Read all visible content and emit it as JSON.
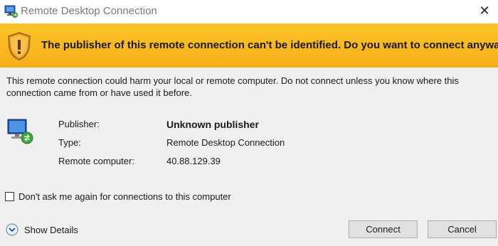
{
  "window": {
    "title": "Remote Desktop Connection",
    "close_glyph": "✕",
    "app_icon": "remote-desktop-icon"
  },
  "banner": {
    "icon": "shield-warning-icon",
    "message": "The publisher of this remote connection can't be identified. Do you want to connect anyway?",
    "color": "#f9b820"
  },
  "description": "This remote connection could harm your local or remote computer. Do not connect unless you know where this connection came from or have used it before.",
  "details": {
    "icon": "remote-computer-icon",
    "rows": [
      {
        "label": "Publisher:",
        "value": "Unknown publisher"
      },
      {
        "label": "Type:",
        "value": "Remote Desktop Connection"
      },
      {
        "label": "Remote computer:",
        "value": "40.88.129.39"
      }
    ]
  },
  "checkbox": {
    "label": "Don't ask me again for connections to this computer",
    "checked": false
  },
  "show_details": {
    "label": "Show Details",
    "icon": "chevron-down-icon"
  },
  "buttons": {
    "connect": "Connect",
    "cancel": "Cancel"
  }
}
